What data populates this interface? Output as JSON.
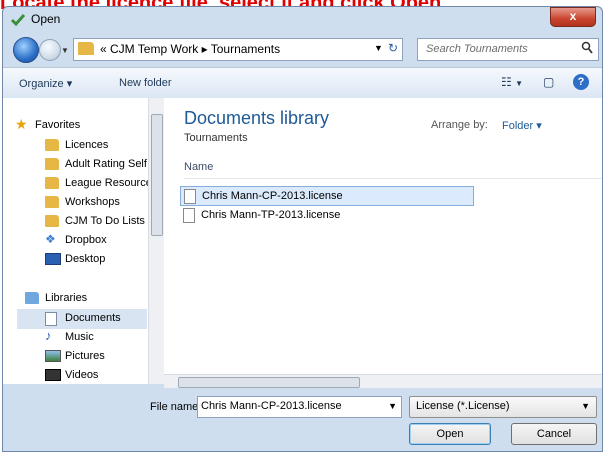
{
  "instruction": "Locate the licence file, select it and click Open",
  "window": {
    "title": "Open",
    "close_label": "x"
  },
  "address": {
    "path": "« CJM Temp Work ▸ Tournaments",
    "search_placeholder": "Search Tournaments"
  },
  "toolbar": {
    "organize": "Organize ▾",
    "new_folder": "New folder"
  },
  "sidebar": {
    "favorites": "Favorites",
    "items": [
      "Licences",
      "Adult Rating Self",
      "League Resource",
      "Workshops",
      "CJM To Do Lists",
      "Dropbox",
      "Desktop"
    ],
    "libraries": "Libraries",
    "lib_items": [
      "Documents",
      "Music",
      "Pictures",
      "Videos"
    ]
  },
  "main": {
    "title": "Documents library",
    "subtitle": "Tournaments",
    "arrange_label": "Arrange by:",
    "arrange_value": "Folder ▾",
    "column_name": "Name",
    "files": [
      "Chris Mann-CP-2013.license",
      "Chris Mann-TP-2013.license"
    ]
  },
  "footer": {
    "file_name_label": "File name:",
    "file_name_value": "Chris Mann-CP-2013.license",
    "file_type": "License (*.License)",
    "open_label": "Open",
    "cancel_label": "Cancel"
  },
  "colors": {
    "instruction": "#e00000",
    "chrome": "#cfdeef",
    "selection": "#dbeafc",
    "link": "#1f5a96"
  }
}
